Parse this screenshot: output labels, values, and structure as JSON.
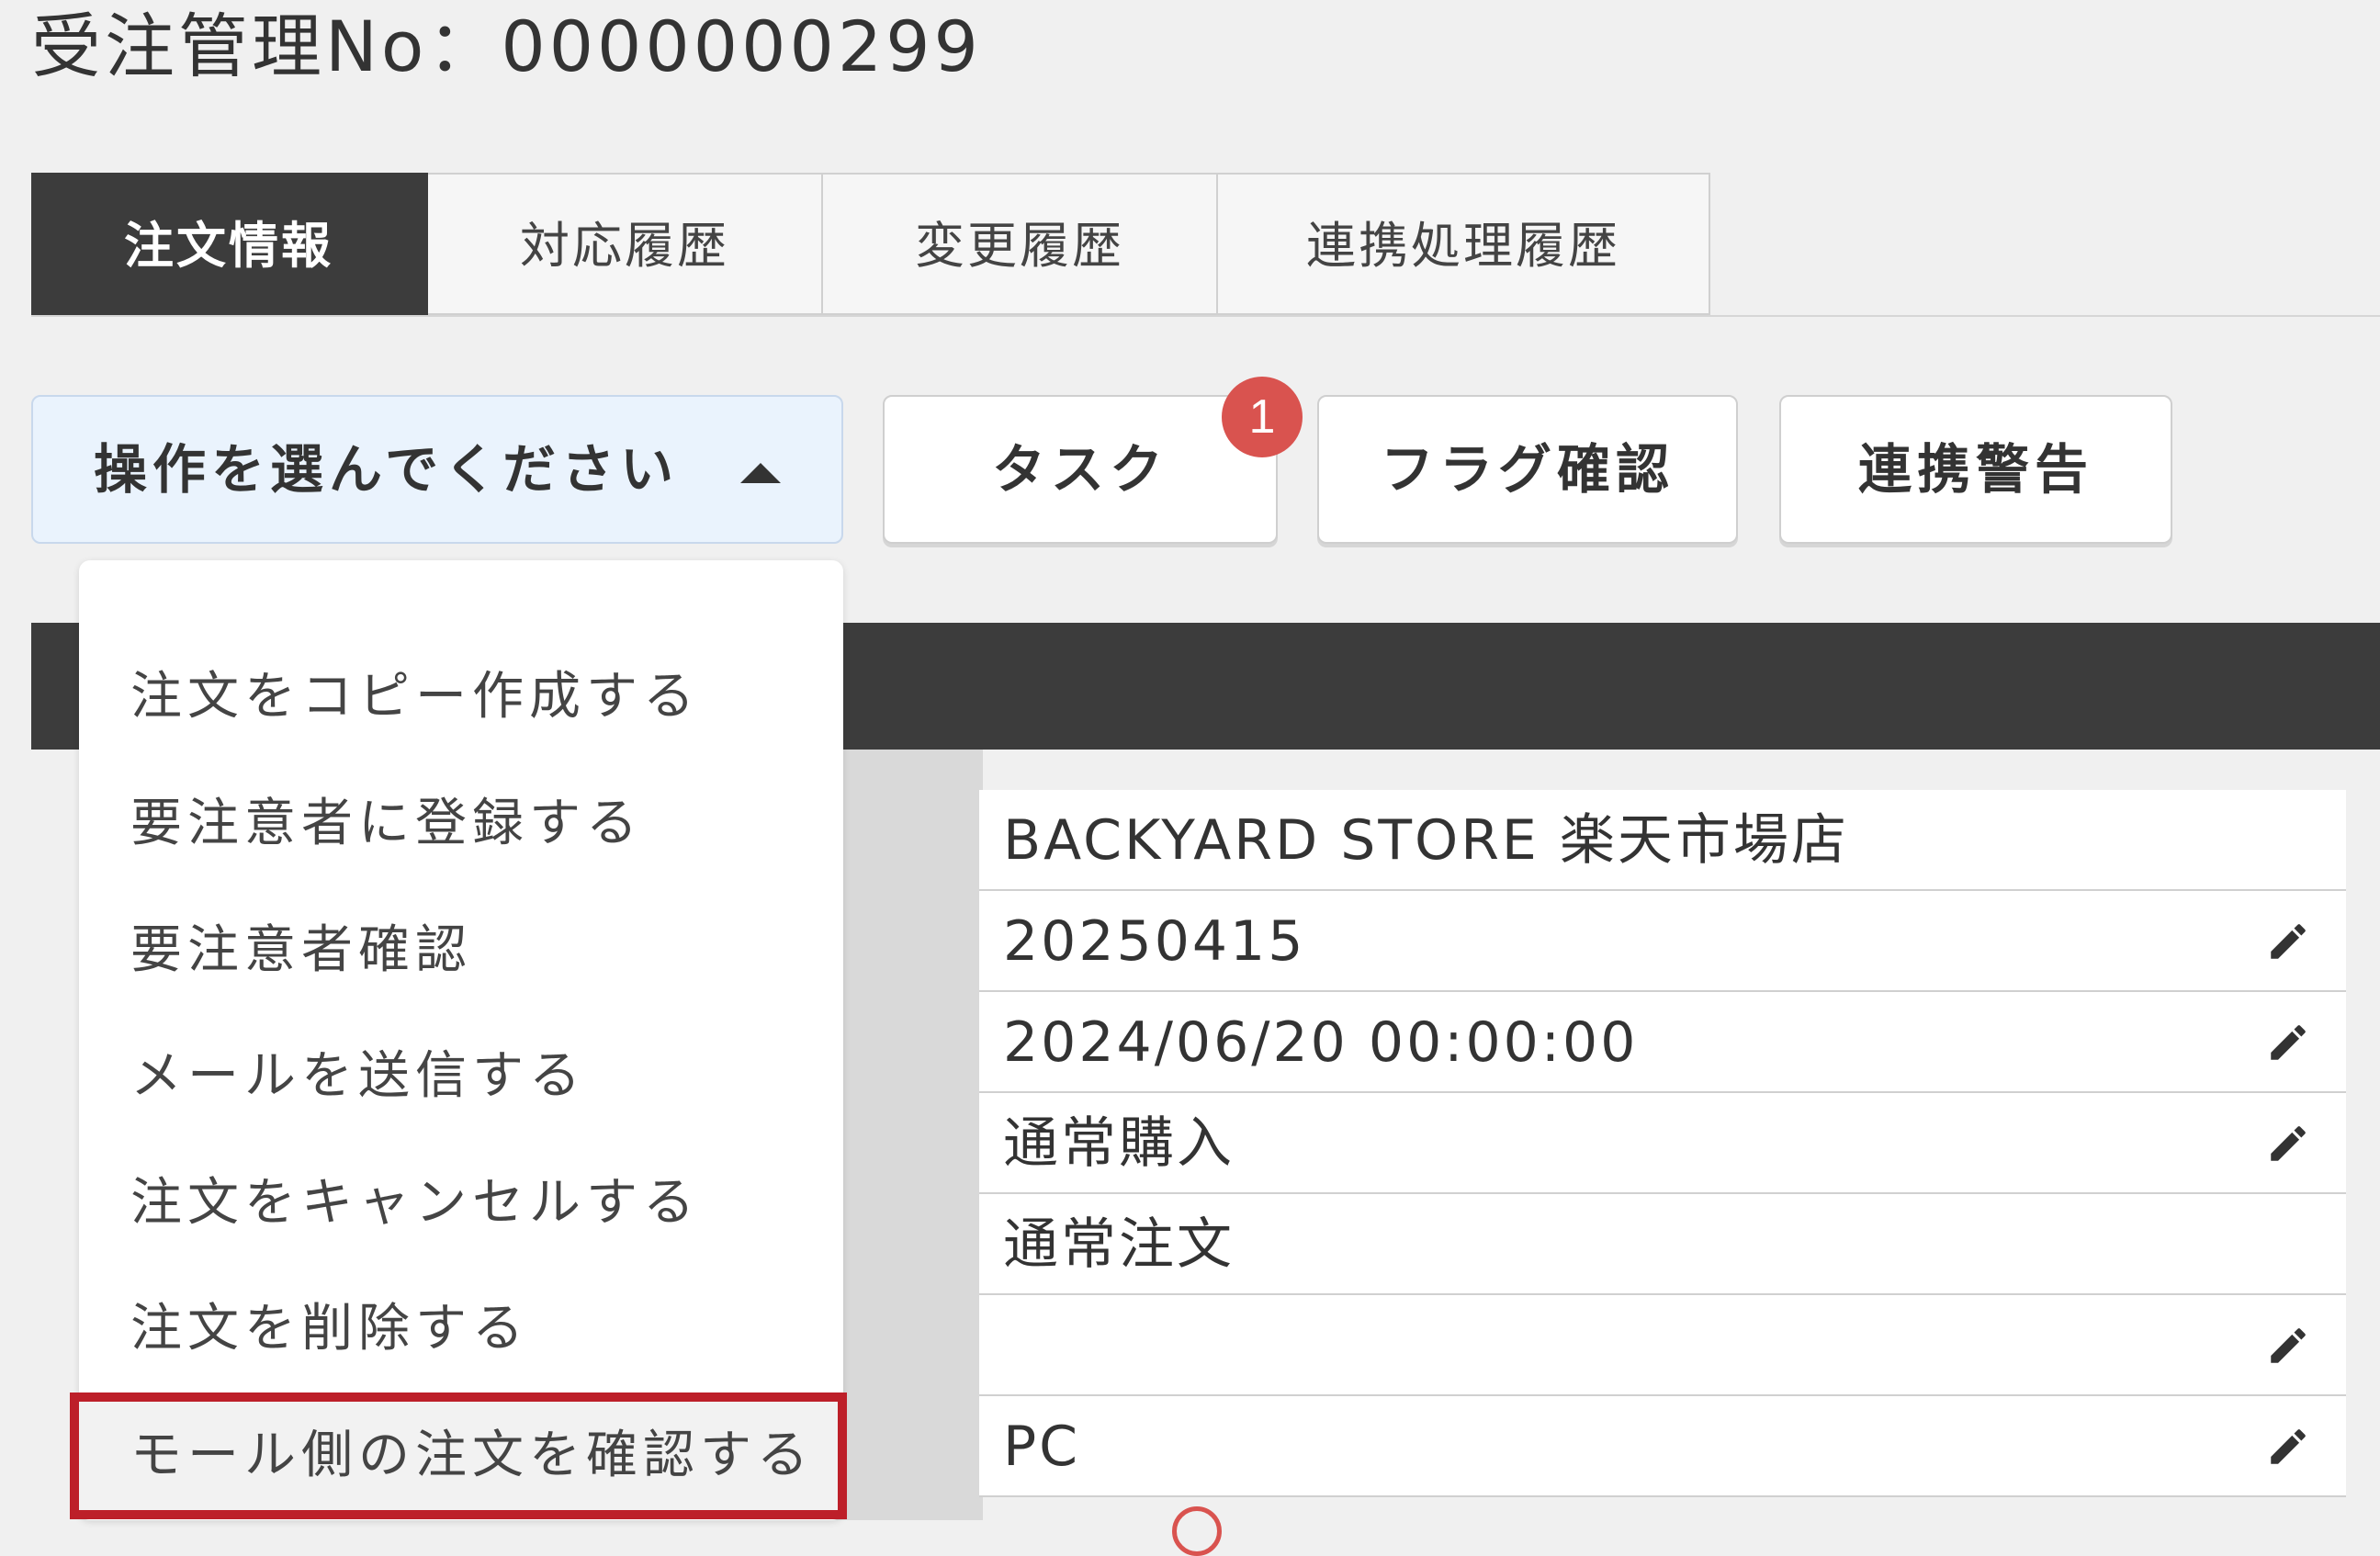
{
  "header": {
    "title": "受注管理No：0000000299"
  },
  "tabs": [
    {
      "label": "注文情報",
      "active": true
    },
    {
      "label": "対応履歴",
      "active": false
    },
    {
      "label": "変更履歴",
      "active": false
    },
    {
      "label": "連携処理履歴",
      "active": false
    }
  ],
  "toolbar": {
    "select_label": "操作を選んでください",
    "task_label": "タスク",
    "task_badge": "1",
    "flag_label": "フラグ確認",
    "warning_label": "連携警告"
  },
  "menu": {
    "items": [
      "注文をコピー作成する",
      "要注意者に登録する",
      "要注意者確認",
      "メールを送信する",
      "注文をキャンセルする",
      "注文を削除する",
      "モール側の注文を確認する"
    ],
    "highlighted_index": 6
  },
  "details": {
    "rows": [
      {
        "value": "BACKYARD STORE 楽天市場店",
        "editable": false
      },
      {
        "value": "20250415",
        "editable": true
      },
      {
        "value": "2024/06/20 00:00:00",
        "editable": true
      },
      {
        "value": "通常購入",
        "editable": true
      },
      {
        "value": "通常注文",
        "editable": false
      },
      {
        "value": "",
        "editable": true
      },
      {
        "value": "PC",
        "editable": true
      }
    ]
  },
  "colors": {
    "dark": "#3c3c3c",
    "highlight_border": "#bd1f29",
    "badge": "#d9534f",
    "select_bg": "#eaf3fd"
  }
}
